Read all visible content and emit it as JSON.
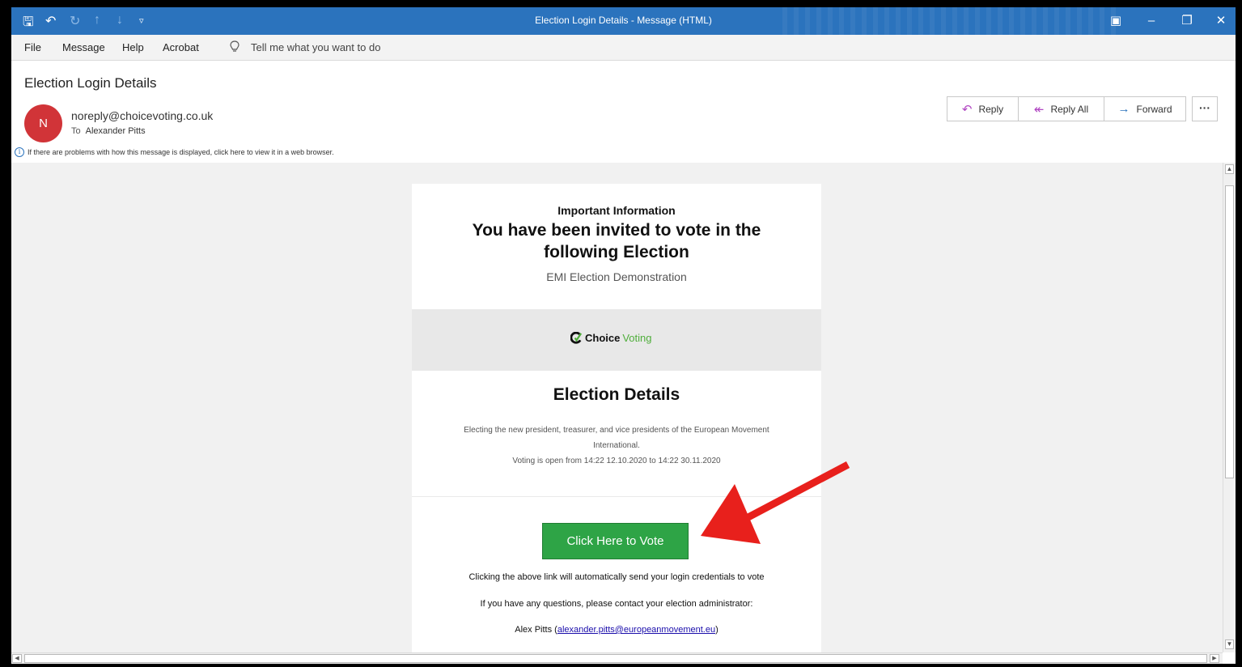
{
  "window": {
    "title": "Election Login Details  -  Message (HTML)"
  },
  "menu": {
    "items": [
      "File",
      "Message",
      "Help",
      "Acrobat"
    ],
    "tell_me": "Tell me what you want to do"
  },
  "header": {
    "subject": "Election Login Details",
    "avatar_initial": "N",
    "sender": "noreply@choicevoting.co.uk",
    "to_label": "To",
    "recipient": "Alexander Pitts",
    "info_bar": "If there are problems with how this message is displayed, click here to view it in a web browser."
  },
  "actions": {
    "reply": "Reply",
    "reply_all": "Reply All",
    "forward": "Forward",
    "more": "···"
  },
  "email": {
    "important": "Important Information",
    "headline_line1": "You have been invited to vote in the",
    "headline_line2": "following Election",
    "election_name": "EMI Election Demonstration",
    "logo_text_1": "Choice",
    "logo_text_2": "Voting",
    "details_title": "Election Details",
    "description_line1": "Electing the new president, treasurer, and vice presidents of the European Movement",
    "description_line2": "International.",
    "voting_window": "Voting is open from 14:22 12.10.2020 to 14:22 30.11.2020",
    "vote_button": "Click Here to Vote",
    "auto_send_note": "Clicking the above link will automatically send your login credentials to vote",
    "questions_note": "If you have any questions, please contact your election administrator:",
    "contact_name": "Alex Pitts (",
    "contact_email": "alexander.pitts@europeanmovement.eu",
    "contact_close": ")"
  },
  "colors": {
    "titlebar": "#2b73bd",
    "avatar": "#d13438",
    "vote_button": "#2ea446",
    "annotation_arrow": "#e8201c"
  },
  "icons": {
    "save": "save-icon",
    "undo": "undo-icon",
    "redo": "redo-icon",
    "up": "arrow-up-icon",
    "down": "arrow-down-icon",
    "customize": "customize-icon",
    "lightbulb": "lightbulb-icon",
    "info": "info-icon",
    "reply": "reply-icon",
    "reply_all": "reply-all-icon",
    "forward": "forward-icon"
  }
}
